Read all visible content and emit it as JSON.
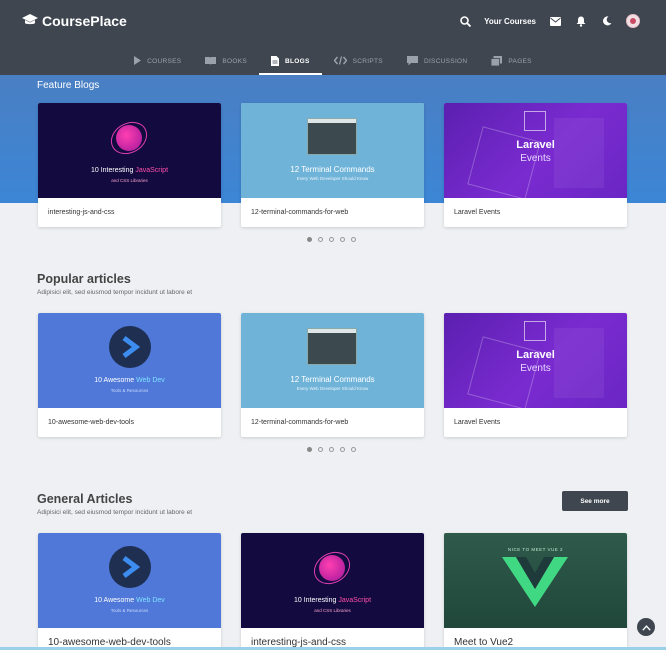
{
  "header": {
    "logo_text": "CoursePlace",
    "your_courses": "Your Courses",
    "icons": [
      "search-icon",
      "mail-icon",
      "bell-icon",
      "moon-icon",
      "avatar"
    ]
  },
  "nav": {
    "items": [
      {
        "label": "COURSES",
        "icon": "play-icon",
        "active": false
      },
      {
        "label": "BOOKS",
        "icon": "book-icon",
        "active": false
      },
      {
        "label": "BLOGS",
        "icon": "document-icon",
        "active": true
      },
      {
        "label": "SCRIPTS",
        "icon": "code-icon",
        "active": false
      },
      {
        "label": "DISCUSSION",
        "icon": "chat-icon",
        "active": false
      },
      {
        "label": "PAGES",
        "icon": "pages-icon",
        "active": false
      }
    ]
  },
  "thumbs": {
    "js": {
      "line1_pre": "10 Interesting ",
      "line1_hl": "JavaScript",
      "line2": "and CSS Libraries"
    },
    "term": {
      "line1": "12 Terminal Commands",
      "line2": "Every Web Developer Should Know"
    },
    "lara": {
      "line1": "Laravel",
      "line2": "Events"
    },
    "web": {
      "line1_pre": "10 Awesome ",
      "line1_hl": "Web Dev",
      "line2": "Tools & Resources"
    },
    "vue": {
      "line0": "NICE TO MEET VUE 2"
    }
  },
  "featured": {
    "title": "Feature Blogs",
    "cards": [
      {
        "label": "interesting-js-and-css"
      },
      {
        "label": "12-terminal-commands-for-web"
      },
      {
        "label": "Laravel Events"
      }
    ],
    "pager": {
      "count": 5,
      "active": 1
    }
  },
  "popular": {
    "title": "Popular articles",
    "subtitle": "Adipisici elit, sed eiusmod tempor incidunt ut labore et",
    "cards": [
      {
        "label": "10-awesome-web-dev-tools"
      },
      {
        "label": "12-terminal-commands-for-web"
      },
      {
        "label": "Laravel Events"
      }
    ],
    "pager": {
      "count": 5,
      "active": 1
    }
  },
  "general": {
    "title": "General Articles",
    "subtitle": "Adipisici elit, sed eiusmod tempor incidunt ut labore et",
    "see_more": "See more",
    "cards": [
      {
        "label": "10-awesome-web-dev-tools"
      },
      {
        "label": "interesting-js-and-css"
      },
      {
        "label": "Meet to Vue2"
      }
    ]
  },
  "colors": {
    "header": "#3f4650",
    "feature_band": "#3c86d6",
    "page_bg": "#eef0f3"
  }
}
